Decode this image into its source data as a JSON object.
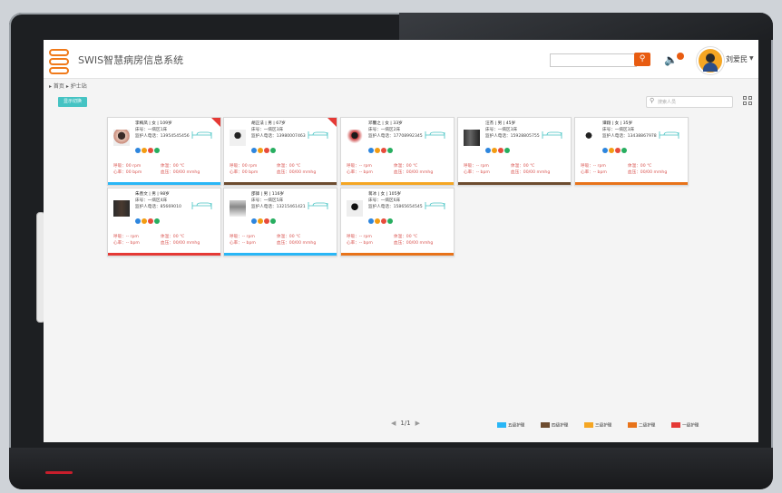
{
  "app": {
    "title": "SWIS智慧病房信息系统",
    "user_name": "刘爱民"
  },
  "breadcrumb": "▸ 首页 ▸ 护士站",
  "toolbar": {
    "toggle_label": "显示切换",
    "search_placeholder": "搜索人员"
  },
  "colors": {
    "brand": "#e85c11",
    "teal": "#45c3c3"
  },
  "patients": [
    {
      "name": "李梅凤 | 女 | 109岁",
      "bed": "床号：一病区1床",
      "phone": "监护人电话：13954545456",
      "vital_rr": "呼吸：00 rpm",
      "vital_hr": "心率：00 bpm",
      "vital_temp": "体温：00 ℃",
      "vital_bp": "血压：00/00 mmhg",
      "care_level": "五级护理",
      "stripe_color": "#29b6f6"
    },
    {
      "name": "胡正法 | 男 | 67岁",
      "bed": "床号：一病区3床",
      "phone": "监护人电话：13980007463",
      "vital_rr": "呼吸：00 rpm",
      "vital_hr": "心率：00 bpm",
      "vital_temp": "体温：00 ℃",
      "vital_bp": "血压：00/00 mmhg",
      "care_level": "四级护理",
      "stripe_color": "#6d4c2f"
    },
    {
      "name": "邓馨之 | 女 | 33岁",
      "bed": "床号：一病区2床",
      "phone": "监护人电话：17708992345",
      "vital_rr": "呼吸：-- rpm",
      "vital_hr": "心率：-- bpm",
      "vital_temp": "体温：00 ℃",
      "vital_bp": "血压：00/00 mmhg",
      "care_level": "三级护理",
      "stripe_color": "#f5a623"
    },
    {
      "name": "汪杰 | 男 | 45岁",
      "bed": "床号：一病区3床",
      "phone": "监护人电话：15928805755",
      "vital_rr": "呼吸：-- rpm",
      "vital_hr": "心率：-- bpm",
      "vital_temp": "体温：00 ℃",
      "vital_bp": "血压：00/00 mmhg",
      "care_level": "四级护理",
      "stripe_color": "#6d4c2f"
    },
    {
      "name": "谭翔 | 女 | 35岁",
      "bed": "床号：一病区3床",
      "phone": "监护人电话：13438867978",
      "vital_rr": "呼吸：-- rpm",
      "vital_hr": "心率：-- bpm",
      "vital_temp": "体温：00 ℃",
      "vital_bp": "血压：00/00 mmhg",
      "care_level": "二级护理",
      "stripe_color": "#e8731a"
    },
    {
      "name": "朱善文 | 男 | 98岁",
      "bed": "床号：一病区4床",
      "phone": "监护人电话：85669010",
      "vital_rr": "呼吸：-- rpm",
      "vital_hr": "心率：-- bpm",
      "vital_temp": "体温：00 ℃",
      "vital_bp": "血压：00/00 mmhg",
      "care_level": "一级护理",
      "stripe_color": "#e53935"
    },
    {
      "name": "邵锋 | 男 | 116岁",
      "bed": "床号：一病区5床",
      "phone": "监护人电话：13215461421",
      "vital_rr": "呼吸：-- rpm",
      "vital_hr": "心率：-- bpm",
      "vital_temp": "体温：00 ℃",
      "vital_bp": "血压：00/00 mmhg",
      "care_level": "五级护理",
      "stripe_color": "#29b6f6"
    },
    {
      "name": "蒋冰 | 女 | 105岁",
      "bed": "床号：一病区6床",
      "phone": "监护人电话：15865654545",
      "vital_rr": "呼吸：-- rpm",
      "vital_hr": "心率：-- bpm",
      "vital_temp": "体温：00 ℃",
      "vital_bp": "血压：00/00 mmhg",
      "care_level": "二级护理",
      "stripe_color": "#e8731a"
    }
  ],
  "pager": {
    "text": "1/1"
  },
  "legend": [
    {
      "label": "五级护理",
      "color": "#29b6f6"
    },
    {
      "label": "四级护理",
      "color": "#6d4c2f"
    },
    {
      "label": "三级护理",
      "color": "#f5a623"
    },
    {
      "label": "二级护理",
      "color": "#e8731a"
    },
    {
      "label": "一级护理",
      "color": "#e53935"
    }
  ]
}
